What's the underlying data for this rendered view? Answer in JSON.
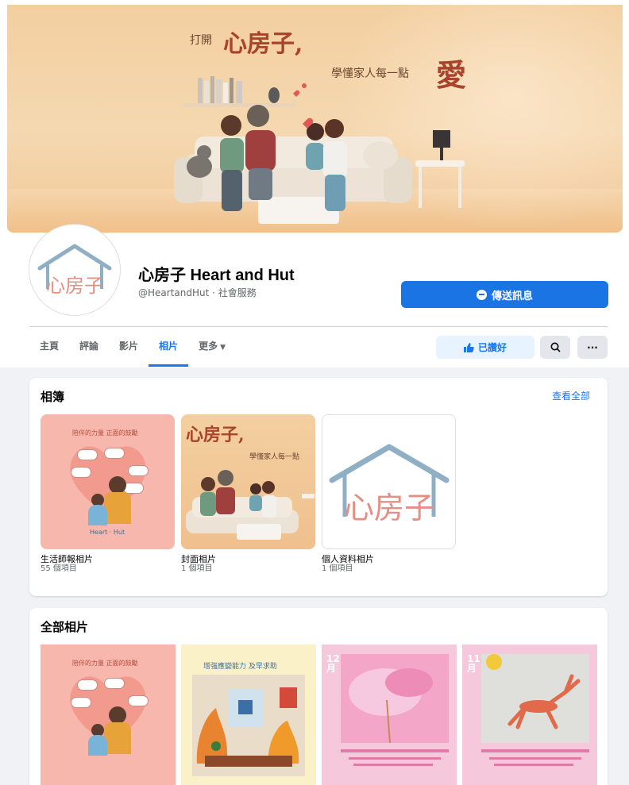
{
  "cover": {
    "line1_a": "打開",
    "line1_b": "心房子,",
    "line2_a": "學懂家人每一點",
    "line2_b": "愛"
  },
  "profile": {
    "name": "心房子 Heart and Hut",
    "handle": "@HeartandHut · 社會服務",
    "avatar_logo_text": "心房子"
  },
  "actions": {
    "message_label": "傳送訊息",
    "liked_label": "已讚好"
  },
  "tabs": [
    {
      "label": "主頁",
      "active": false
    },
    {
      "label": "評論",
      "active": false
    },
    {
      "label": "影片",
      "active": false
    },
    {
      "label": "相片",
      "active": true
    },
    {
      "label": "更多",
      "active": false
    }
  ],
  "albums": {
    "title": "相簿",
    "see_all": "查看全部",
    "items": [
      {
        "name": "生活師報相片",
        "count": "55 個項目"
      },
      {
        "name": "封面相片",
        "count": "1 個項目"
      },
      {
        "name": "個人資料相片",
        "count": "1 個項目"
      }
    ]
  },
  "all_photos": {
    "title": "全部相片"
  },
  "thumb_text": {
    "heart_caption": "陪伴的力量 正面的鼓勵",
    "fire_caption": "增強應變能力 及早求助",
    "month_12": "12 月",
    "month_11": "11 月",
    "cover_small_a": "心房子,",
    "cover_small_b": "學懂家人每一點"
  },
  "colors": {
    "brand_blue": "#1877f2",
    "button_blue": "#1b74e4",
    "pink_thumb": "#f8b7ad"
  }
}
